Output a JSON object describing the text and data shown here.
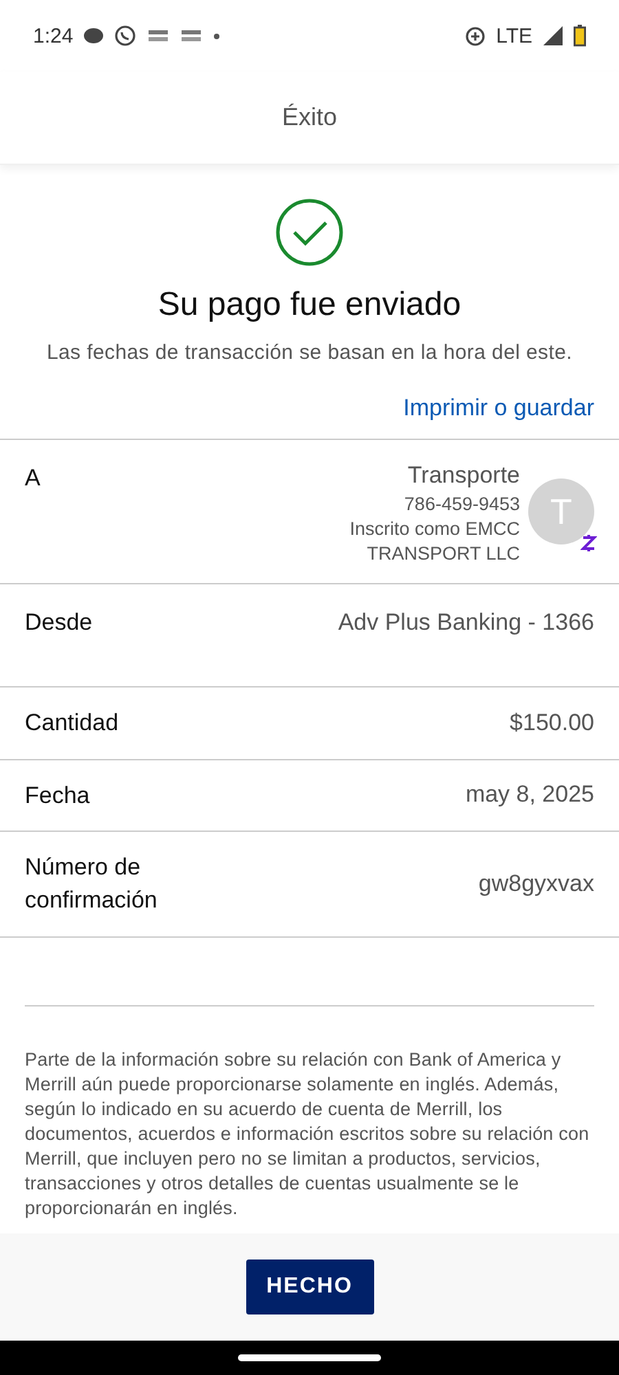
{
  "status_bar": {
    "time": "1:24",
    "network": "LTE"
  },
  "header": {
    "title": "Éxito"
  },
  "confirmation": {
    "title": "Su pago fue enviado",
    "subtitle": "Las fechas de transacción se basan en la hora del este.",
    "link": "Imprimir o guardar"
  },
  "details": [
    {
      "kind": "recipient",
      "label": "A",
      "name": "Transporte",
      "phone": "786-459-9453",
      "registered": "Inscrito como EMCC",
      "company": "TRANSPORT LLC",
      "avatar": "T"
    },
    {
      "kind": "plain",
      "label": "Desde",
      "value": "Adv Plus Banking - 1366"
    },
    {
      "kind": "plain",
      "label": "Cantidad",
      "value": "$150.00"
    },
    {
      "kind": "plain",
      "label": "Fecha",
      "value": "may 8, 2025"
    },
    {
      "kind": "plain",
      "label": "Número de confirmación",
      "value": "gw8gyxvax"
    }
  ],
  "disclaimer": "Parte de la información sobre su relación con Bank of America y Merrill aún puede proporcionarse solamente en inglés. Además, según lo indicado en su acuerdo de cuenta de Merrill, los documentos, acuerdos e información escritos sobre su relación con Merrill, que incluyen pero no se limitan a productos, servicios, transacciones y otros detalles de cuentas usualmente se le proporcionarán en inglés.",
  "footer": {
    "button": "HECHO"
  }
}
